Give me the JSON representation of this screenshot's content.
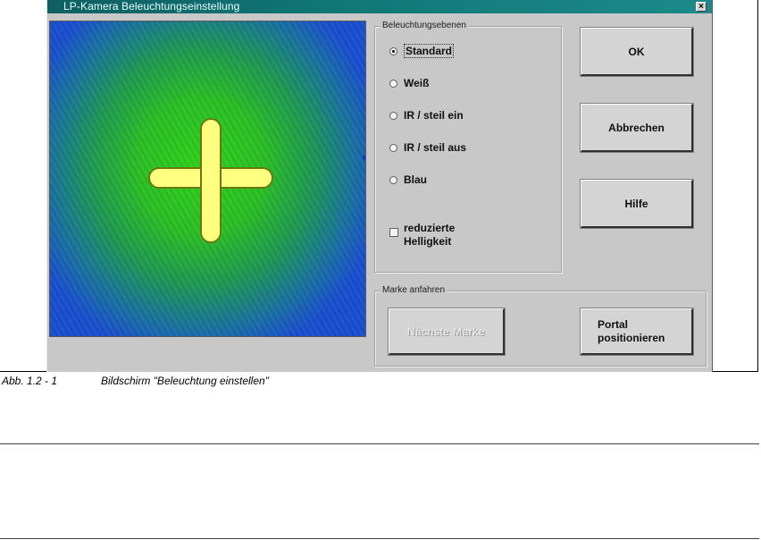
{
  "window": {
    "title": "LP-Kamera Beleuchtungseinstellung",
    "close_label": "×"
  },
  "levels_group": {
    "label": "Beleuchtungsebenen",
    "options": [
      {
        "label": "Standard",
        "selected": true
      },
      {
        "label": "Weiß",
        "selected": false
      },
      {
        "label": "IR / steil ein",
        "selected": false
      },
      {
        "label": "IR / steil aus",
        "selected": false
      },
      {
        "label": "Blau",
        "selected": false
      }
    ],
    "reduced_brightness_label": "reduzierte Helligkeit",
    "reduced_brightness_checked": false
  },
  "buttons": {
    "ok": "OK",
    "cancel": "Abbrechen",
    "help": "Hilfe"
  },
  "mark_group": {
    "label": "Marke anfahren",
    "next_mark": "Nächste Marke",
    "next_mark_enabled": false,
    "portal_position": "Portal positionieren"
  },
  "caption": {
    "number": "Abb. 1.2 - 1",
    "text": "Bildschirm \"Beleuchtung einstellen\""
  },
  "colors": {
    "titlebar": "#117777",
    "dialog_bg": "#c8c8c8",
    "crosshair": "#ffff80",
    "camera_green": "#2fd21a",
    "camera_blue": "#1a4fd0"
  }
}
